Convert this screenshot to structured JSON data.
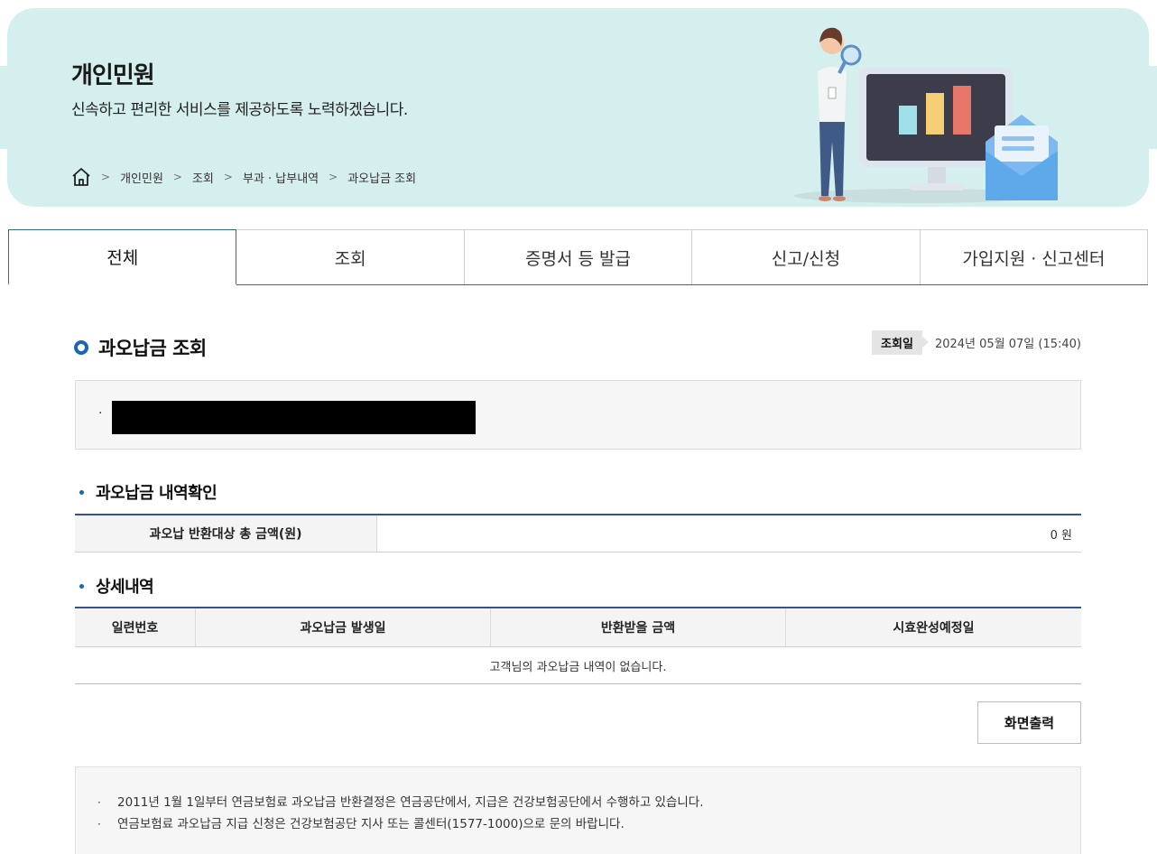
{
  "hero": {
    "title": "개인민원",
    "subtitle": "신속하고 편리한 서비스를 제공하도록 노력하겠습니다.",
    "breadcrumb": [
      "개인민원",
      "조회",
      "부과 · 납부내역",
      "과오납금 조회"
    ],
    "home_icon": "home-icon",
    "separator": ">"
  },
  "tabs": [
    "전체",
    "조회",
    "증명서 등 발급",
    "신고/신청",
    "가입지원 · 신고센터"
  ],
  "page": {
    "title": "과오납금 조회",
    "query_date_label": "조회일",
    "query_date": "2024년 05월 07일 (15:40)",
    "info_bullet": "·"
  },
  "summary": {
    "section_title": "과오납금 내역확인",
    "label": "과오납 반환대상 총 금액(원)",
    "value": "0 원"
  },
  "detail": {
    "section_title": "상세내역",
    "columns": [
      "일련번호",
      "과오납금 발생일",
      "반환받을 금액",
      "시효완성예정일"
    ],
    "empty_message": "고객님의 과오납금 내역이 없습니다."
  },
  "buttons": {
    "print": "화면출력"
  },
  "notices": [
    "2011년 1월 1일부터 연금보험료 과오납금 반환결정은 연금공단에서, 지급은 건강보험공단에서 수행하고 있습니다.",
    "연금보험료 과오납금 지급 신청은 건강보험공단 지사 또는 콜센터(1577-1000)으로 문의 바랍니다."
  ],
  "notice_bullet": "·",
  "colors": {
    "hero_bg": "#d5eeee",
    "accent": "#1767b5",
    "table_top": "#34528f"
  }
}
